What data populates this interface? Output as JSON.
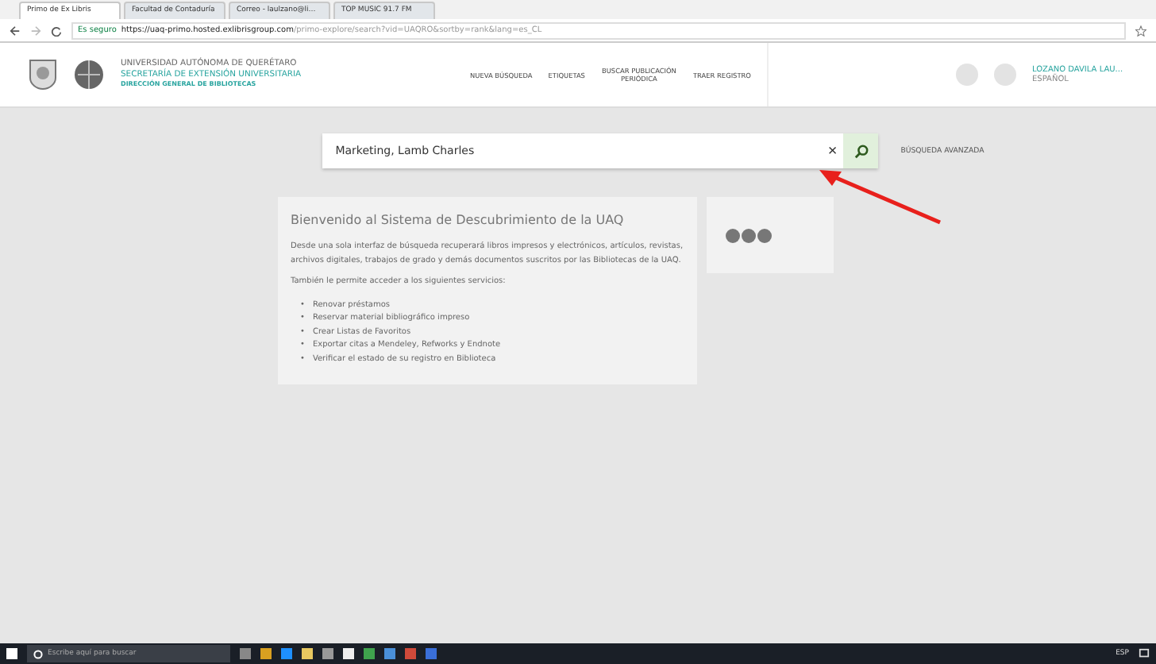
{
  "browser": {
    "tabs": [
      {
        "label": "Primo de Ex Libris",
        "selected": true
      },
      {
        "label": "Facultad de Contaduría",
        "selected": false
      },
      {
        "label": "Correo - laulzano@li…",
        "selected": false
      },
      {
        "label": "TOP MUSIC 91.7 FM",
        "selected": false
      }
    ],
    "secure_label": "Es seguro",
    "url_host": "https://uaq-primo.hosted.exlibrisgroup.com",
    "url_path": "/primo-explore/search?vid=UAQRO&sortby=rank&lang=es_CL"
  },
  "header": {
    "org_lines": [
      "UNIVERSIDAD AUTÓNOMA DE QUERÉTARO",
      "SECRETARÍA DE EXTENSIÓN UNIVERSITARIA",
      "DIRECCIÓN GENERAL DE BIBLIOTECAS"
    ],
    "nav": [
      "NUEVA BÚSQUEDA",
      "ETIQUETAS",
      "BUSCAR PUBLICACIÓN PERIÓDICA",
      "TRAER REGISTRO"
    ],
    "user": "LOZANO DAVILA LAU...",
    "language": "ESPAÑOL"
  },
  "search": {
    "value": "Marketing, Lamb Charles",
    "clear": "×",
    "advanced": "BÚSQUEDA AVANZADA"
  },
  "welcome": {
    "title": "Bienvenido al Sistema de Descubrimiento de la UAQ",
    "paragraphs": [
      "Desde una sola interfaz de búsqueda recuperará libros impresos y electrónicos, artículos, revistas, archivos digitales, trabajos de grado y demás documentos suscritos por las Bibliotecas de la UAQ.",
      "También le permite acceder a los siguientes servicios:"
    ],
    "services": [
      {
        "marker": "•",
        "text": "Renovar préstamos"
      },
      {
        "marker": "•",
        "text": "Reservar material bibliográfico impreso"
      },
      {
        "marker": "•",
        "text": "Crear Listas de Favoritos"
      },
      {
        "marker": "•",
        "text": "Exportar citas a Mendeley, Refworks y Endnote"
      },
      {
        "marker": "•",
        "text": "Verificar el estado de su registro en Biblioteca"
      }
    ]
  },
  "taskbar": {
    "search_placeholder": "Escribe aquí para buscar",
    "language": "ESP"
  }
}
